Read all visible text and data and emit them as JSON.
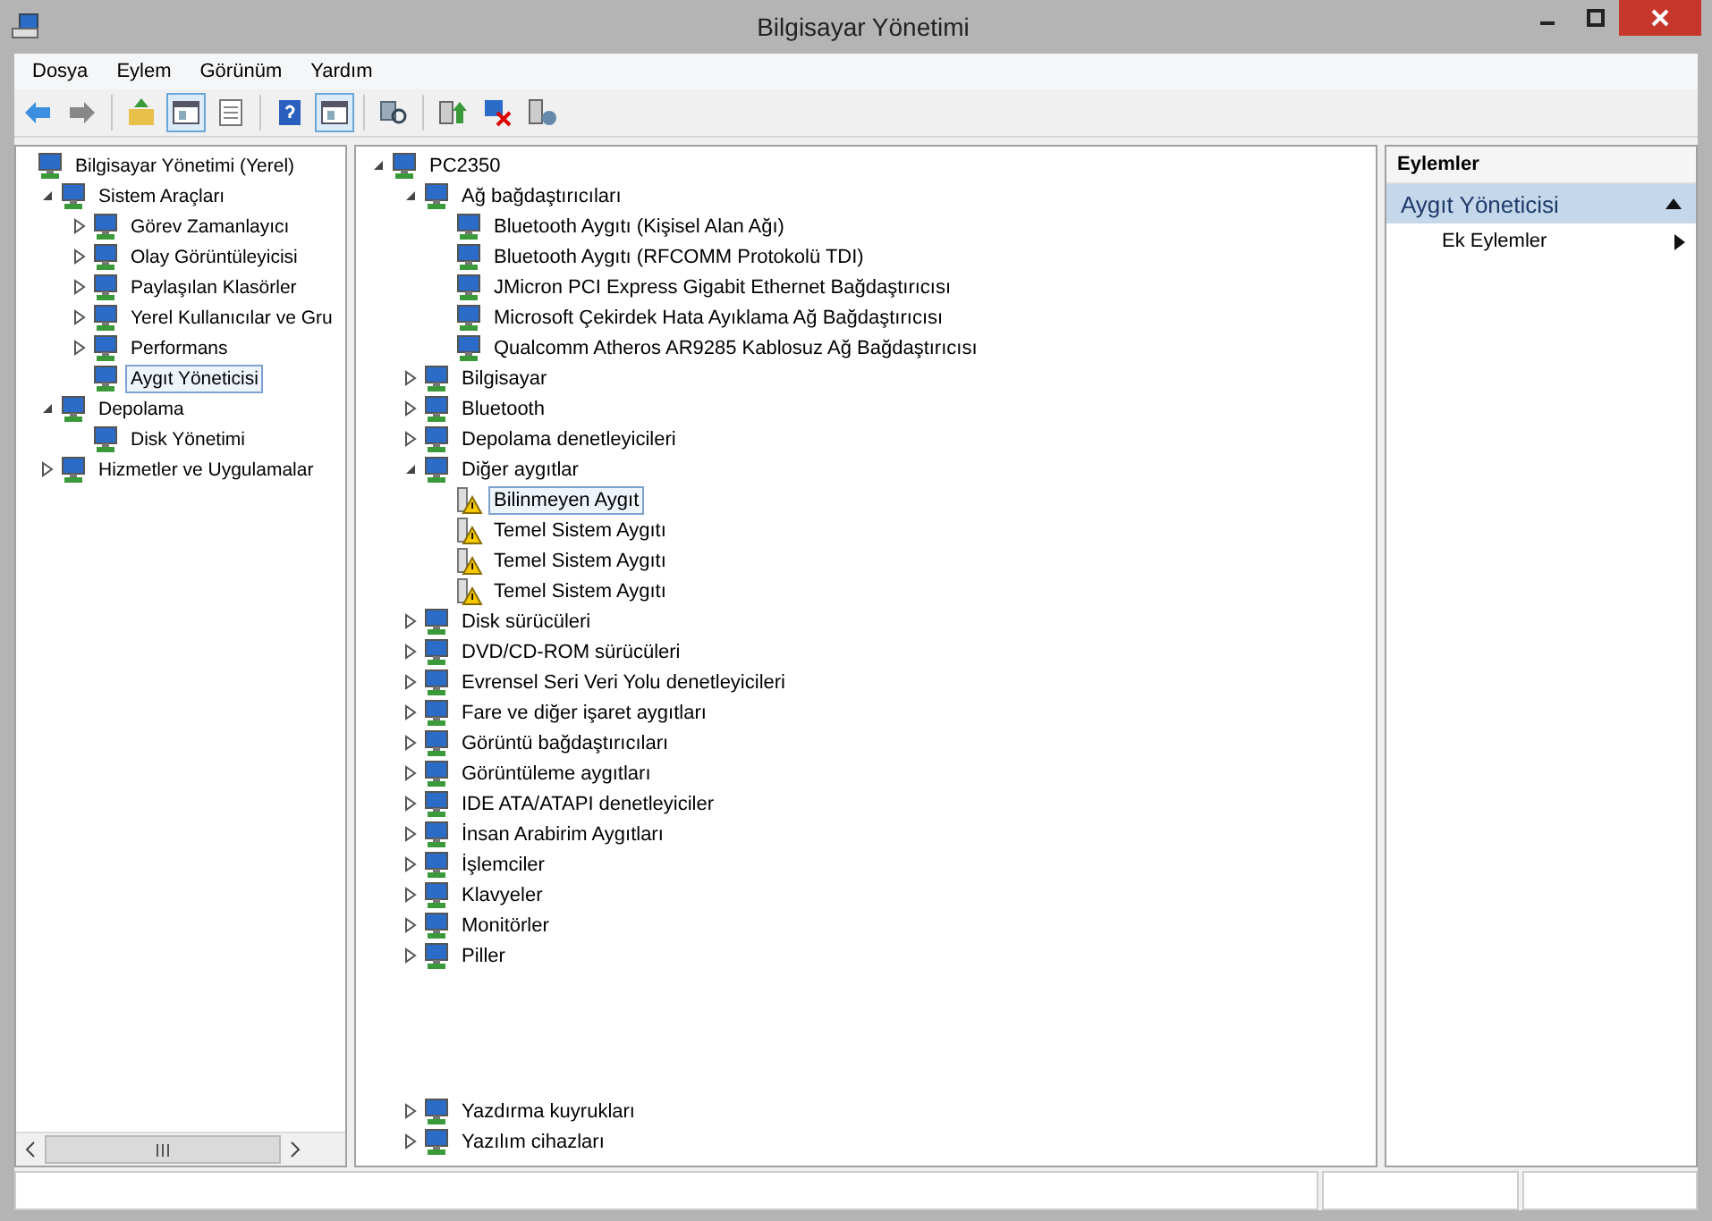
{
  "window": {
    "title": "Bilgisayar Yönetimi"
  },
  "menu": [
    "Dosya",
    "Eylem",
    "Görünüm",
    "Yardım"
  ],
  "toolbar": [
    {
      "kind": "back",
      "on": false
    },
    {
      "kind": "forward",
      "on": false
    },
    {
      "kind": "sep"
    },
    {
      "kind": "up",
      "on": false
    },
    {
      "kind": "tree",
      "on": true
    },
    {
      "kind": "properties",
      "on": false
    },
    {
      "kind": "sep"
    },
    {
      "kind": "help",
      "on": false
    },
    {
      "kind": "actions",
      "on": true
    },
    {
      "kind": "sep"
    },
    {
      "kind": "scan",
      "on": false
    },
    {
      "kind": "sep"
    },
    {
      "kind": "update",
      "on": false
    },
    {
      "kind": "disable",
      "on": false
    },
    {
      "kind": "uninstall",
      "on": false
    }
  ],
  "left_tree": [
    {
      "label": "Bilgisayar Yönetimi (Yerel)",
      "selected": false,
      "children": [
        {
          "label": "Sistem Araçları",
          "expanded": true,
          "selected": false,
          "children": [
            {
              "label": "Görev Zamanlayıcı",
              "expanded": false,
              "selected": false
            },
            {
              "label": "Olay Görüntüleyicisi",
              "expanded": false,
              "selected": false
            },
            {
              "label": "Paylaşılan Klasörler",
              "expanded": false,
              "selected": false
            },
            {
              "label": "Yerel Kullanıcılar ve Gru",
              "expanded": false,
              "selected": false
            },
            {
              "label": "Performans",
              "expanded": false,
              "selected": false
            },
            {
              "label": "Aygıt Yöneticisi",
              "selected": true
            }
          ]
        },
        {
          "label": "Depolama",
          "expanded": true,
          "selected": false,
          "children": [
            {
              "label": "Disk Yönetimi",
              "selected": false
            }
          ]
        },
        {
          "label": "Hizmetler ve Uygulamalar",
          "expanded": false,
          "selected": false
        }
      ]
    }
  ],
  "device_tree": [
    {
      "label": "PC2350",
      "expanded": true,
      "selected": false,
      "children": [
        {
          "label": "Ağ bağdaştırıcıları",
          "expanded": true,
          "selected": false,
          "children": [
            {
              "label": "Bluetooth Aygıtı (Kişisel Alan Ağı)",
              "selected": false,
              "warning": false
            },
            {
              "label": "Bluetooth Aygıtı (RFCOMM Protokolü TDI)",
              "selected": false,
              "warning": false
            },
            {
              "label": "JMicron PCI Express Gigabit Ethernet Bağdaştırıcısı",
              "selected": false,
              "warning": false
            },
            {
              "label": "Microsoft Çekirdek Hata Ayıklama Ağ Bağdaştırıcısı",
              "selected": false,
              "warning": false
            },
            {
              "label": "Qualcomm Atheros AR9285 Kablosuz Ağ Bağdaştırıcısı",
              "selected": false,
              "warning": false
            }
          ]
        },
        {
          "label": "Bilgisayar",
          "expanded": false,
          "selected": false
        },
        {
          "label": "Bluetooth",
          "expanded": false,
          "selected": false
        },
        {
          "label": "Depolama denetleyicileri",
          "expanded": false,
          "selected": false
        },
        {
          "label": "Diğer aygıtlar",
          "expanded": true,
          "selected": false,
          "children": [
            {
              "label": "Bilinmeyen Aygıt",
              "selected": true,
              "warning": true
            },
            {
              "label": "Temel Sistem Aygıtı",
              "selected": false,
              "warning": true
            },
            {
              "label": "Temel Sistem Aygıtı",
              "selected": false,
              "warning": true
            },
            {
              "label": "Temel Sistem Aygıtı",
              "selected": false,
              "warning": true
            }
          ]
        },
        {
          "label": "Disk sürücüleri",
          "expanded": false,
          "selected": false
        },
        {
          "label": "DVD/CD-ROM sürücüleri",
          "expanded": false,
          "selected": false
        },
        {
          "label": "Evrensel Seri Veri Yolu denetleyicileri",
          "expanded": false,
          "selected": false
        },
        {
          "label": "Fare ve diğer işaret aygıtları",
          "expanded": false,
          "selected": false
        },
        {
          "label": "Görüntü bağdaştırıcıları",
          "expanded": false,
          "selected": false
        },
        {
          "label": "Görüntüleme aygıtları",
          "expanded": false,
          "selected": false
        },
        {
          "label": "IDE ATA/ATAPI denetleyiciler",
          "expanded": false,
          "selected": false
        },
        {
          "label": "İnsan Arabirim Aygıtları",
          "expanded": false,
          "selected": false
        },
        {
          "label": "İşlemciler",
          "expanded": false,
          "selected": false
        },
        {
          "label": "Klavyeler",
          "expanded": false,
          "selected": false
        },
        {
          "label": "Monitörler",
          "expanded": false,
          "selected": false
        },
        {
          "label": "Piller",
          "expanded": false,
          "selected": false
        },
        {
          "label": "Yazdırma kuyrukları",
          "expanded": false,
          "selected": false
        },
        {
          "label": "Yazılım cihazları",
          "expanded": false,
          "selected": false
        }
      ]
    }
  ],
  "actions": {
    "header": "Eylemler",
    "section": {
      "title": "Aygıt Yöneticisi",
      "expanded": true
    },
    "items": [
      "Ek Eylemler"
    ]
  }
}
